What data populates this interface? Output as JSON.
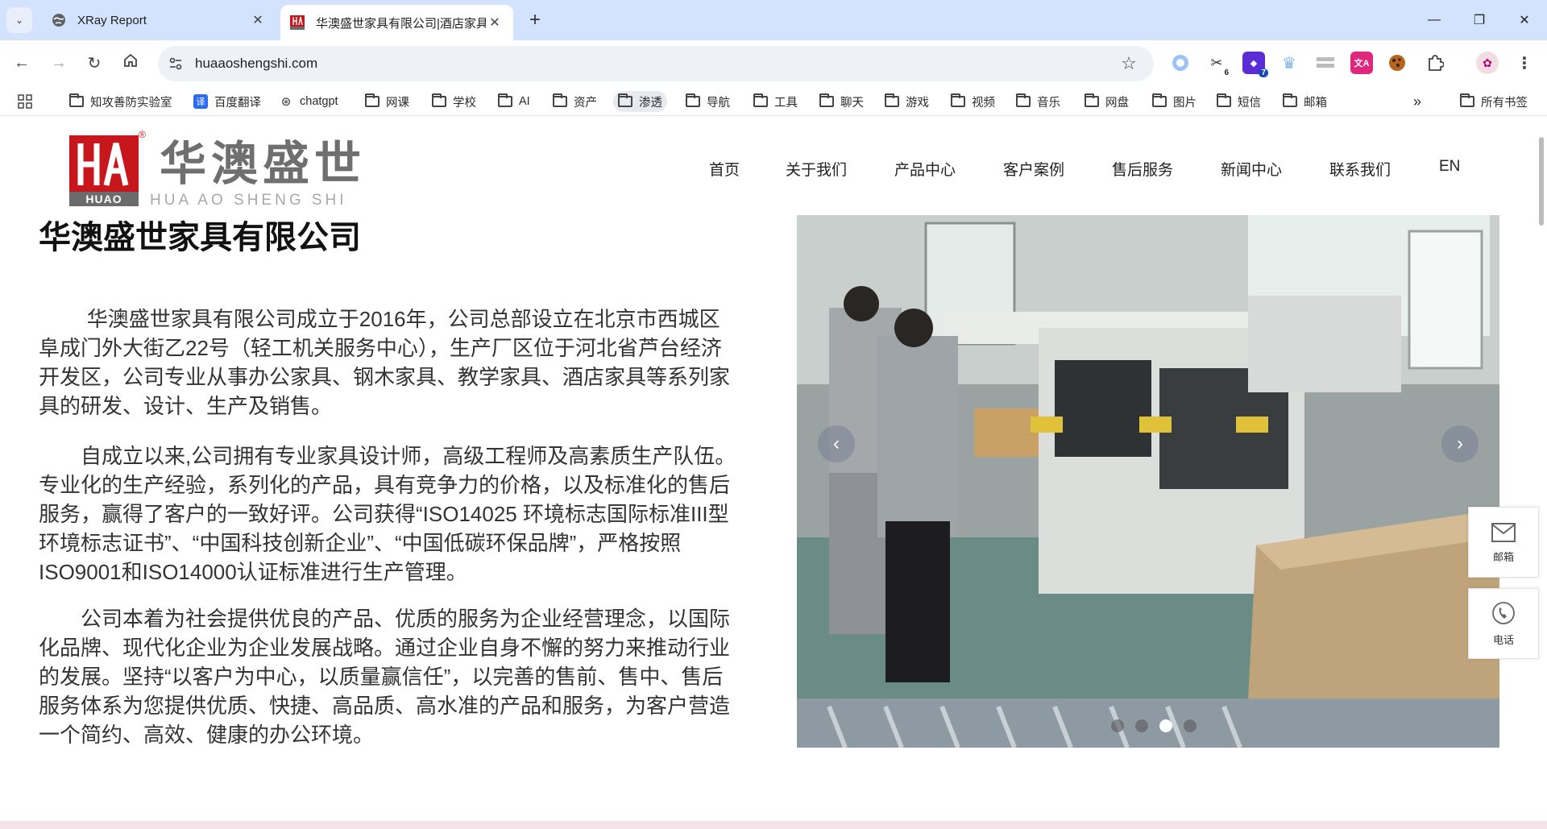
{
  "browser": {
    "tabs": [
      {
        "title": "XRay Report",
        "icon": "globe-icon"
      },
      {
        "title": "华澳盛世家具有限公司|酒店家具",
        "icon": "huao-logo-icon"
      }
    ],
    "url": "huaaoshengshi.com",
    "extension_badges": {
      "ext2": "6",
      "ext3": "7"
    },
    "bookmarks": [
      {
        "label": "知攻善防实验室",
        "type": "folder"
      },
      {
        "label": "百度翻译",
        "type": "site",
        "glyph": "译"
      },
      {
        "label": "chatgpt",
        "type": "site",
        "glyph": "⊛"
      },
      {
        "label": "网课",
        "type": "folder"
      },
      {
        "label": "学校",
        "type": "folder"
      },
      {
        "label": "AI",
        "type": "folder"
      },
      {
        "label": "资产",
        "type": "folder"
      },
      {
        "label": "渗透",
        "type": "folder"
      },
      {
        "label": "导航",
        "type": "folder"
      },
      {
        "label": "工具",
        "type": "folder"
      },
      {
        "label": "聊天",
        "type": "folder"
      },
      {
        "label": "游戏",
        "type": "folder"
      },
      {
        "label": "视频",
        "type": "folder"
      },
      {
        "label": "音乐",
        "type": "folder"
      },
      {
        "label": "网盘",
        "type": "folder"
      },
      {
        "label": "图片",
        "type": "folder"
      },
      {
        "label": "短信",
        "type": "folder"
      },
      {
        "label": "邮箱",
        "type": "folder"
      }
    ],
    "all_bookmarks": "所有书签",
    "overflow": "»"
  },
  "site": {
    "logo": {
      "cn": "华澳盛世",
      "en": "HUA AO SHENG SHI",
      "mark_text": "HUAO",
      "reg": "®"
    },
    "nav": [
      "首页",
      "关于我们",
      "产品中心",
      "客户案例",
      "售后服务",
      "新闻中心",
      "联系我们",
      "EN"
    ],
    "company_title": "华澳盛世家具有限公司",
    "paragraphs": [
      "华澳盛世家具有限公司成立于2016年，公司总部设立在北京市西城区阜成门外大街乙22号（轻工机关服务中心），生产厂区位于河北省芦台经济开发区，公司专业从事办公家具、钢木家具、教学家具、酒店家具等系列家具的研发、设计、生产及销售。",
      "自成立以来,公司拥有专业家具设计师，高级工程师及高素质生产队伍。专业化的生产经验，系列化的产品，具有竞争力的价格，以及标准化的售后服务，赢得了客户的一致好评。公司获得“ISO14025 环境标志国际标准III型环境标志证书”、“中国科技创新企业”、“中国低碳环保品牌”，严格按照ISO9001和ISO14000认证标准进行生产管理。",
      "公司本着为社会提供优良的产品、优质的服务为企业经营理念，以国际化品牌、现代化企业为企业发展战略。通过企业自身不懈的努力来推动行业的发展。坚持“以客户为中心，以质量赢信任”，以完善的售前、售中、售后服务体系为您提供优质、快捷、高品质、高水准的产品和服务，为客户营造一个简约、高效、健康的办公环境。"
    ],
    "slider": {
      "slide_count": 4,
      "active_index": 2
    },
    "side": {
      "mail_label": "邮箱",
      "phone_label": "电话"
    }
  }
}
